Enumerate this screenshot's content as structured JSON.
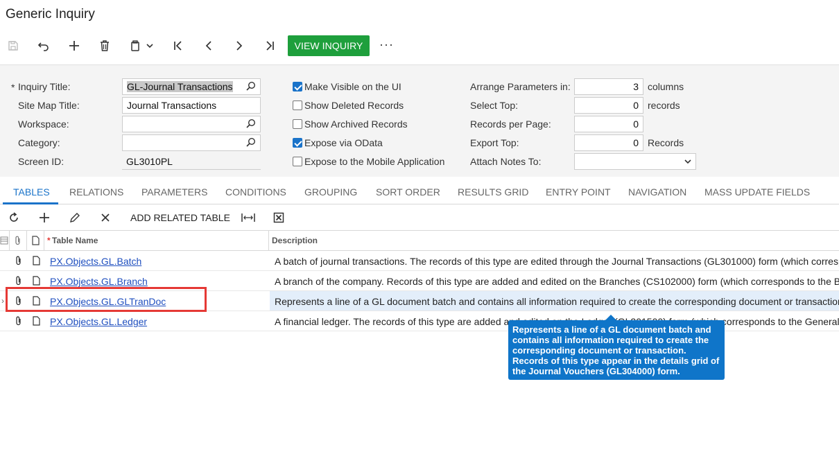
{
  "page": {
    "title": "Generic Inquiry"
  },
  "toolbar": {
    "view_inquiry": "VIEW INQUIRY",
    "more": "···"
  },
  "form": {
    "inquiry_title_label": "Inquiry Title:",
    "inquiry_title_value": "GL-Journal Transactions",
    "site_map_title_label": "Site Map Title:",
    "site_map_title_value": "Journal Transactions",
    "workspace_label": "Workspace:",
    "category_label": "Category:",
    "screen_id_label": "Screen ID:",
    "screen_id_value": "GL3010PL",
    "make_visible_label": "Make Visible on the UI",
    "show_deleted_label": "Show Deleted Records",
    "show_archived_label": "Show Archived Records",
    "expose_odata_label": "Expose via OData",
    "expose_mobile_label": "Expose to the Mobile Application",
    "arrange_label": "Arrange Parameters in:",
    "arrange_value": "3",
    "arrange_unit": "columns",
    "select_top_label": "Select Top:",
    "select_top_value": "0",
    "select_top_unit": "records",
    "records_per_page_label": "Records per Page:",
    "records_per_page_value": "0",
    "export_top_label": "Export Top:",
    "export_top_value": "0",
    "export_top_unit": "Records",
    "attach_notes_label": "Attach Notes To:",
    "attach_notes_value": ""
  },
  "checkboxes": {
    "make_visible": true,
    "show_deleted": false,
    "show_archived": false,
    "expose_odata": true,
    "expose_mobile": false
  },
  "tabs": [
    "TABLES",
    "RELATIONS",
    "PARAMETERS",
    "CONDITIONS",
    "GROUPING",
    "SORT ORDER",
    "RESULTS GRID",
    "ENTRY POINT",
    "NAVIGATION",
    "MASS UPDATE FIELDS"
  ],
  "grid_toolbar": {
    "add_related_table": "ADD RELATED TABLE"
  },
  "grid": {
    "columns": {
      "table_name": "Table Name",
      "description": "Description"
    },
    "rows": [
      {
        "name": "PX.Objects.GL.Batch",
        "description": "A batch of journal transactions. The records of this type are edited through the Journal Transactions (GL301000) form (which corresponds to the"
      },
      {
        "name": "PX.Objects.GL.Branch",
        "description": "A branch of the company. Records of this type are added and edited on the Branches (CS102000) form (which corresponds to the BranchMaint"
      },
      {
        "name": "PX.Objects.GL.GLTranDoc",
        "description": "Represents a line of a GL document batch and contains all information required to create the corresponding document or transaction. Records"
      },
      {
        "name": "PX.Objects.GL.Ledger",
        "description": "A financial ledger. The records of this type are added and edited on the Ledger (GL201500) form (which corresponds to the GeneralLedgerMaint"
      }
    ]
  },
  "tooltip": {
    "text": "Represents a line of a GL document batch and contains all information required to create the corresponding document or transaction. Records of this type appear in the details grid of the Journal Vouchers (GL304000) form."
  },
  "colors": {
    "accent": "#1a73c9",
    "primary_button": "#1e9f3c",
    "highlight": "#e53935",
    "tooltip": "#0f75c9"
  }
}
